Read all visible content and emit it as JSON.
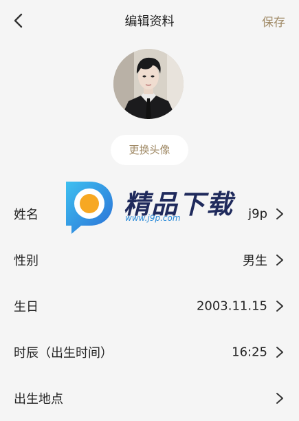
{
  "header": {
    "title": "编辑资料",
    "save_label": "保存"
  },
  "avatar": {
    "description_icon": "avatar-portrait"
  },
  "change_avatar_label": "更换头像",
  "rows": [
    {
      "label": "姓名",
      "value": "j9p"
    },
    {
      "label": "性别",
      "value": "男生"
    },
    {
      "label": "生日",
      "value": "2003.11.15"
    },
    {
      "label": "时辰（出生时间）",
      "value": "16:25"
    },
    {
      "label": "出生地点",
      "value": ""
    }
  ],
  "watermark": {
    "brand": "精品下载",
    "url": "www.j9p.com"
  },
  "colors": {
    "background": "#f5f5f5",
    "accent": "#a08a66",
    "text": "#222222"
  }
}
